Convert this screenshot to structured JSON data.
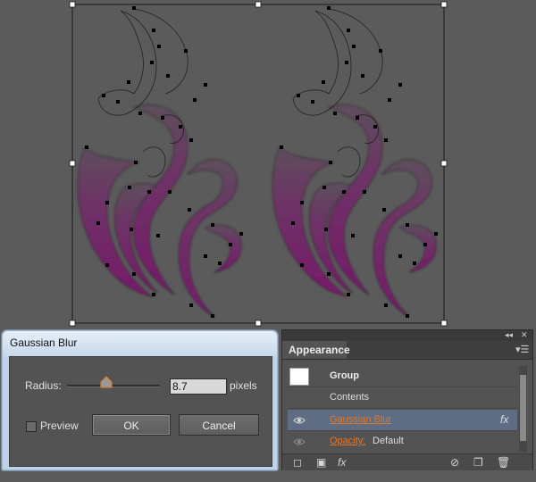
{
  "dialog": {
    "title": "Gaussian Blur",
    "radius_label": "Radius:",
    "radius_value": "8.7",
    "radius_unit": "pixels",
    "preview_label": "Preview",
    "preview_checked": false,
    "ok_label": "OK",
    "cancel_label": "Cancel"
  },
  "appearance": {
    "tab_label": "Appearance",
    "rows": {
      "group": "Group",
      "contents": "Contents",
      "effect": "Gaussian Blur",
      "effect_badge": "fx",
      "opacity_label": "Opacity:",
      "opacity_value": "Default"
    },
    "bottom_fx": "fx"
  },
  "colors": {
    "artwork_fill": "#6e2467",
    "selection_accent": "#5e6c84",
    "link_orange": "#e0782c"
  },
  "icons": [
    "collapse-icon",
    "close-icon",
    "panel-menu-icon",
    "eye-icon",
    "fx-icon",
    "new-stroke-icon",
    "new-fill-icon",
    "clear-appearance-icon",
    "duplicate-icon",
    "trash-icon",
    "slider-thumb-icon"
  ]
}
